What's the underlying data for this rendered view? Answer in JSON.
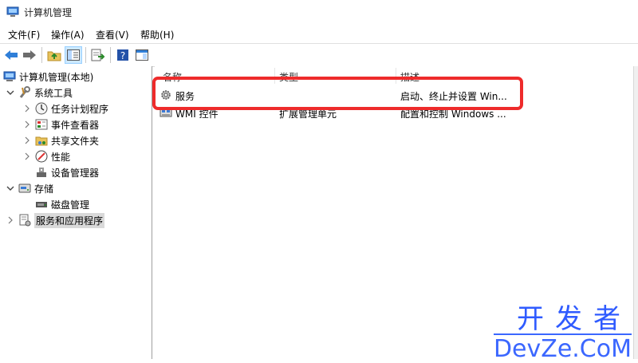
{
  "window": {
    "title": "计算机管理"
  },
  "menu": {
    "items": [
      "文件(F)",
      "操作(A)",
      "查看(V)",
      "帮助(H)"
    ]
  },
  "tree": {
    "root": "计算机管理(本地)",
    "system_tools": "系统工具",
    "task_scheduler": "任务计划程序",
    "event_viewer": "事件查看器",
    "shared_folders": "共享文件夹",
    "performance": "性能",
    "device_manager": "设备管理器",
    "storage": "存储",
    "disk_management": "磁盘管理",
    "services_apps": "服务和应用程序"
  },
  "list": {
    "columns": [
      "名称",
      "类型",
      "描述"
    ],
    "rows": [
      {
        "name": "服务",
        "type": "",
        "desc": "启动、终止并设置 Win..."
      },
      {
        "name": "WMI 控件",
        "type": "扩展管理单元",
        "desc": "配置和控制 Windows ..."
      }
    ]
  },
  "watermark": {
    "cn": "开发者",
    "en": "DevZe.CoM"
  },
  "colors": {
    "highlight": "#ee2b2b",
    "watermark": "#3b67ff",
    "selection": "#cce8ff"
  }
}
